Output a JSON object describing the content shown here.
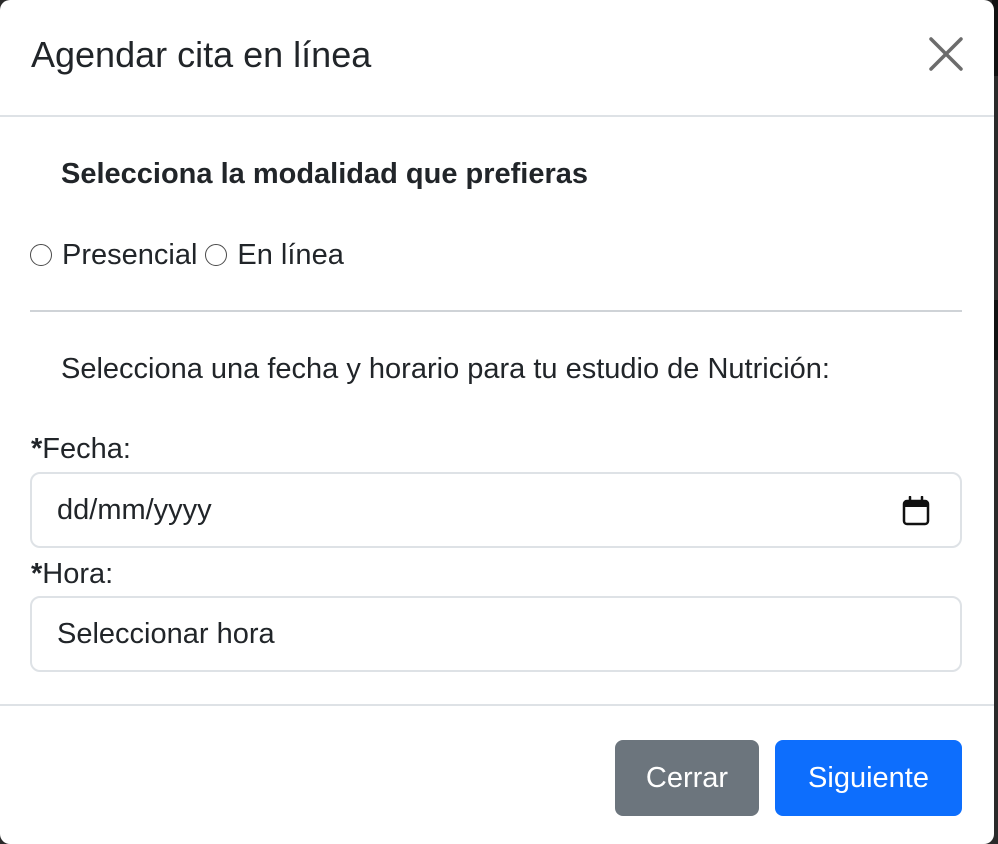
{
  "modal": {
    "title": "Agendar cita en línea",
    "close_icon": "close-icon"
  },
  "modality": {
    "heading": "Selecciona la modalidad que prefieras",
    "options": [
      {
        "label": "Presencial",
        "selected": false
      },
      {
        "label": "En línea",
        "selected": false
      }
    ]
  },
  "schedule": {
    "instruction": "Selecciona una fecha y horario para tu estudio de Nutrición:",
    "date": {
      "required_mark": "*",
      "label": "Fecha:",
      "placeholder": "dd/mm/yyyy",
      "icon": "calendar-icon"
    },
    "time": {
      "required_mark": "*",
      "label": "Hora:",
      "placeholder": "Seleccionar hora"
    }
  },
  "footer": {
    "close_label": "Cerrar",
    "next_label": "Siguiente"
  },
  "colors": {
    "primary": "#0d6efd",
    "secondary": "#6c757d",
    "border": "#dee2e6",
    "text": "#212529"
  }
}
